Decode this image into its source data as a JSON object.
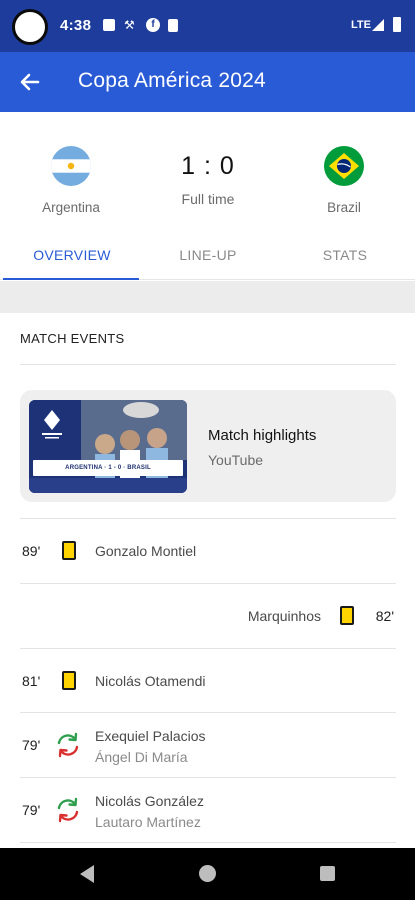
{
  "status_bar": {
    "time": "4:38",
    "network": "LTE",
    "icons": [
      "message-icon",
      "tool-icon",
      "facebook-icon",
      "sim-icon",
      "signal-icon",
      "battery-icon"
    ]
  },
  "app_bar": {
    "title": "Copa América 2024",
    "back_icon": "arrow-back-icon",
    "background": "#2a5bd7"
  },
  "match": {
    "home_team": "Argentina",
    "away_team": "Brazil",
    "score": "1 : 0",
    "status": "Full time"
  },
  "tabs": [
    {
      "label": "OVERVIEW",
      "active": true
    },
    {
      "label": "LINE-UP",
      "active": false
    },
    {
      "label": "STATS",
      "active": false
    }
  ],
  "events": {
    "section_title": "MATCH EVENTS",
    "highlight": {
      "title": "Match highlights",
      "source": "YouTube",
      "thumbnail_caption": "ARGENTINA · 1 - 0 · BRASIL"
    },
    "items": [
      {
        "minute": "89'",
        "type": "yellow-card",
        "side": "home",
        "player": "Gonzalo Montiel"
      },
      {
        "minute": "82'",
        "type": "yellow-card",
        "side": "away",
        "player": "Marquinhos"
      },
      {
        "minute": "81'",
        "type": "yellow-card",
        "side": "home",
        "player": "Nicolás Otamendi"
      },
      {
        "minute": "79'",
        "type": "substitution",
        "side": "home",
        "player_in": "Exequiel Palacios",
        "player_out": "Ángel Di María"
      },
      {
        "minute": "79'",
        "type": "substitution",
        "side": "home",
        "player_in": "Nicolás González",
        "player_out": "Lautaro Martínez"
      }
    ]
  },
  "colors": {
    "status_bar": "#1d3c9c",
    "accent": "#2a5bd7",
    "yellow_card": "#ffd400",
    "sub_in": "#2e9e4f",
    "sub_out": "#d93030"
  }
}
